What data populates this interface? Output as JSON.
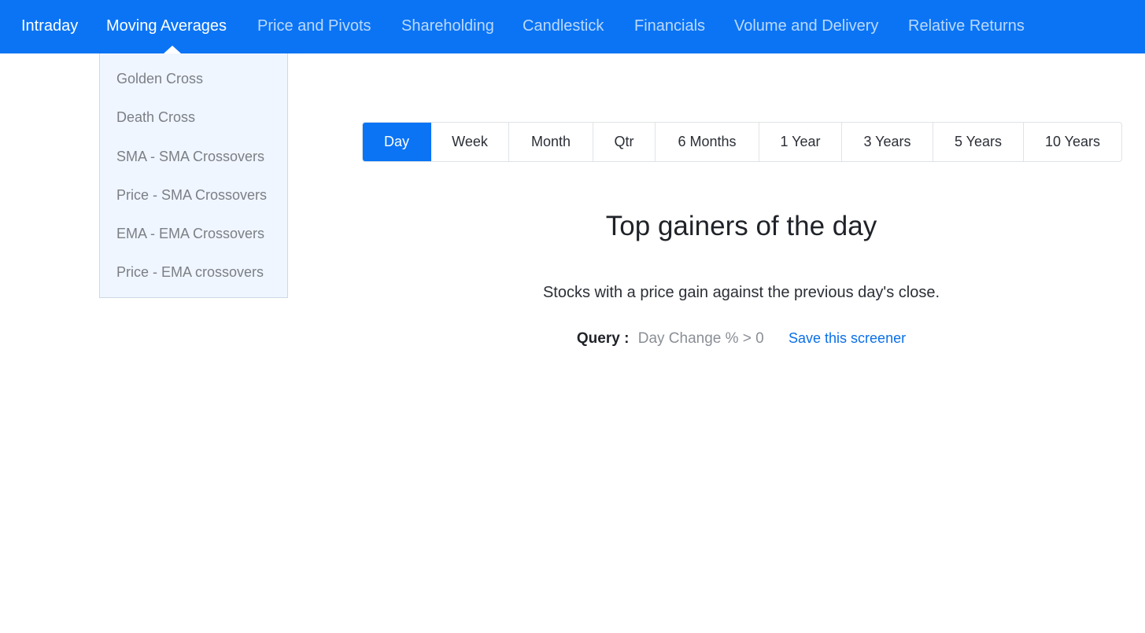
{
  "nav": {
    "items": [
      {
        "label": "Intraday"
      },
      {
        "label": "Moving Averages"
      },
      {
        "label": "Price and Pivots"
      },
      {
        "label": "Shareholding"
      },
      {
        "label": "Candlestick"
      },
      {
        "label": "Financials"
      },
      {
        "label": "Volume and Delivery"
      },
      {
        "label": "Relative Returns"
      }
    ],
    "active": "Moving Averages",
    "color": "#0a74f5"
  },
  "dropdown": {
    "items": [
      {
        "label": "Golden Cross"
      },
      {
        "label": "Death Cross"
      },
      {
        "label": "SMA - SMA Crossovers"
      },
      {
        "label": "Price - SMA Crossovers"
      },
      {
        "label": "EMA - EMA Crossovers"
      },
      {
        "label": "Price - EMA crossovers"
      }
    ]
  },
  "periods": {
    "items": [
      {
        "label": "Day"
      },
      {
        "label": "Week"
      },
      {
        "label": "Month"
      },
      {
        "label": "Qtr"
      },
      {
        "label": "6 Months"
      },
      {
        "label": "1 Year"
      },
      {
        "label": "3 Years"
      },
      {
        "label": "5 Years"
      },
      {
        "label": "10 Years"
      }
    ],
    "selected": "Day"
  },
  "content": {
    "title": "Top gainers of the day",
    "description": "Stocks with a price gain against the previous day's close.",
    "query_label": "Query :",
    "query_value": "Day Change % > 0",
    "save_label": "Save this screener"
  }
}
